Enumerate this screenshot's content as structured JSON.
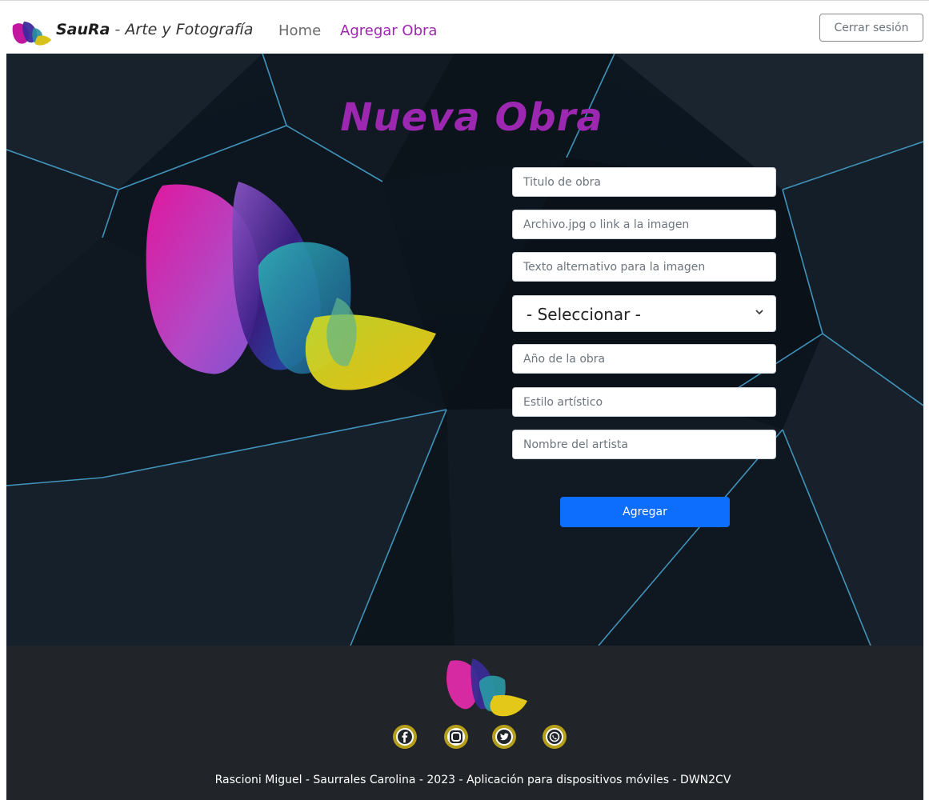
{
  "navbar": {
    "brand_name": "SauRa",
    "brand_separator": " - ",
    "brand_tagline": "Arte y Fotografía",
    "links": {
      "home": "Home",
      "add_work": "Agregar Obra"
    },
    "logout_label": "Cerrar sesión"
  },
  "form": {
    "title": "Nueva Obra",
    "fields": {
      "title": {
        "placeholder": "Titulo de obra",
        "value": ""
      },
      "image": {
        "placeholder": "Archivo.jpg o link a la imagen",
        "value": ""
      },
      "alt_text": {
        "placeholder": "Texto alternativo para la imagen",
        "value": ""
      },
      "year": {
        "placeholder": "Año de la obra",
        "value": ""
      },
      "style": {
        "placeholder": "Estilo artístico",
        "value": ""
      },
      "artist": {
        "placeholder": "Nombre del artista",
        "value": ""
      }
    },
    "category_select": {
      "selected": "- Seleccionar -"
    },
    "submit_label": "Agregar"
  },
  "footer": {
    "social": [
      "facebook-icon",
      "instagram-icon",
      "twitter-icon",
      "whatsapp-icon"
    ],
    "credits": "Rascioni Miguel - Saurrales Carolina - 2023 - Aplicación para dispositivos móviles - DWN2CV"
  },
  "colors": {
    "accent_purple": "#9c27b0",
    "primary_button": "#0d6efd",
    "footer_bg": "#212529",
    "hero_bg": "#0e1620",
    "social_ring": "#b49e1a"
  }
}
